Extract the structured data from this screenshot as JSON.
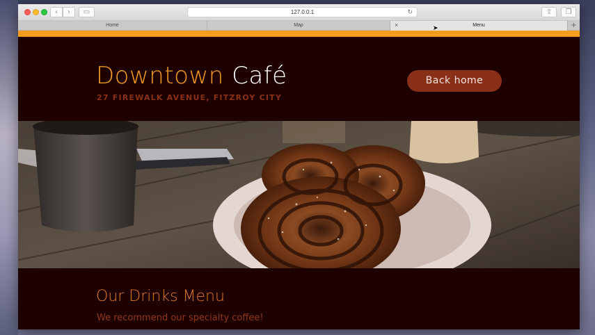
{
  "browser": {
    "url": "127.0.0.1",
    "tabs": [
      {
        "label": "Home"
      },
      {
        "label": "Map"
      },
      {
        "label": "Menu"
      }
    ]
  },
  "header": {
    "brand_part1": "Downtown",
    "brand_part2": "Café",
    "address": "27 FIREWALK AVENUE, FITZROY CITY",
    "back_home_label": "Back home"
  },
  "section": {
    "title": "Our Drinks Menu",
    "subtitle": "We recommend our specialty coffee!"
  },
  "colors": {
    "accent": "#f49b1e",
    "background": "#1e0000",
    "button": "#8a2f18",
    "brand_orange": "#f29a22"
  }
}
